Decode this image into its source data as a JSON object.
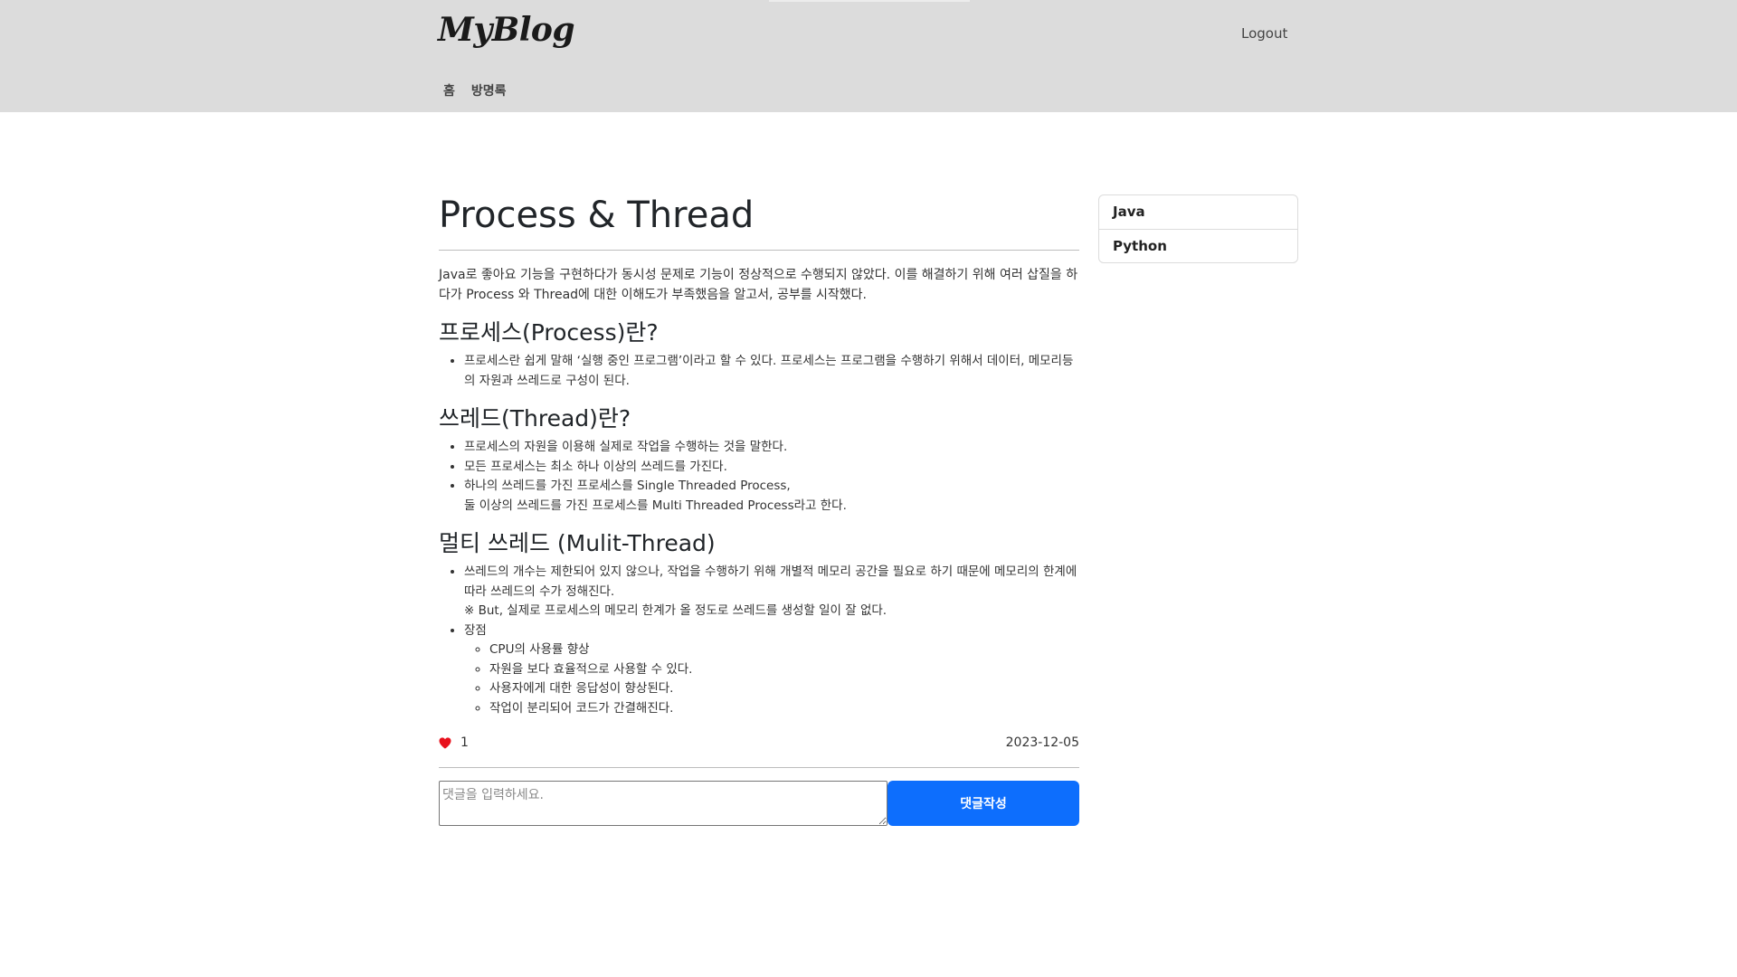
{
  "header": {
    "logo": "MyBlog",
    "logout_label": "Logout",
    "nav": [
      {
        "label": "홈"
      },
      {
        "label": "방명록"
      }
    ]
  },
  "post": {
    "title": "Process & Thread",
    "intro": "Java로 좋아요 기능을 구현하다가 동시성 문제로 기능이 정상적으로 수행되지 않았다. 이를 해결하기 위해 여러 삽질을 하다가 Process 와 Thread에 대한 이해도가 부족했음을 알고서, 공부를 시작했다.",
    "sections": [
      {
        "heading": "프로세스(Process)란?",
        "items": [
          {
            "text": "프로세스란 쉽게 말해 ‘실행 중인 프로그램’이라고 할 수 있다. 프로세스는 프로그램을 수행하기 위해서 데이터, 메모리등의 자원과 쓰레드로 구성이 된다."
          }
        ]
      },
      {
        "heading": "쓰레드(Thread)란?",
        "items": [
          {
            "text": "프로세스의 자원을 이용해 실제로 작업을 수행하는 것을 말한다."
          },
          {
            "text": "모든 프로세스는 최소 하나 이상의 쓰레드를 가진다."
          },
          {
            "text": "하나의 쓰레드를 가진 프로세스를 Single Threaded Process,",
            "text2": "둘 이상의 쓰레드를 가진 프로세스를 Multi Threaded Process라고 한다."
          }
        ]
      },
      {
        "heading": "멀티 쓰레드 (Mulit-Thread)",
        "items": [
          {
            "text": "쓰레드의 개수는 제한되어 있지 않으나, 작업을 수행하기 위해 개별적 메모리 공간을 필요로 하기 때문에 메모리의 한계에 따라 쓰레드의 수가 정해진다.",
            "text2": "※ But, 실제로 프로세스의 메모리 한계가 올 정도로 쓰레드를 생성할 일이 잘 없다."
          },
          {
            "text": "장점",
            "sub": [
              "CPU의 사용률 향상",
              "자원을 보다 효율적으로 사용할 수 있다.",
              "사용자에게 대한 응답성이 향상된다.",
              "작업이 분리되어 코드가 간결해진다."
            ]
          }
        ]
      }
    ],
    "like_count": "1",
    "date": "2023-12-05"
  },
  "comment": {
    "placeholder": "댓글을 입력하세요.",
    "value": "",
    "submit_label": "댓글작성"
  },
  "sidebar": {
    "categories": [
      {
        "label": "Java"
      },
      {
        "label": "Python"
      }
    ]
  },
  "colors": {
    "header_bg": "#dcdcdc",
    "accent": "#0d6efd",
    "heart": "#e8101c"
  },
  "icons": {
    "heart": "heart-icon"
  }
}
